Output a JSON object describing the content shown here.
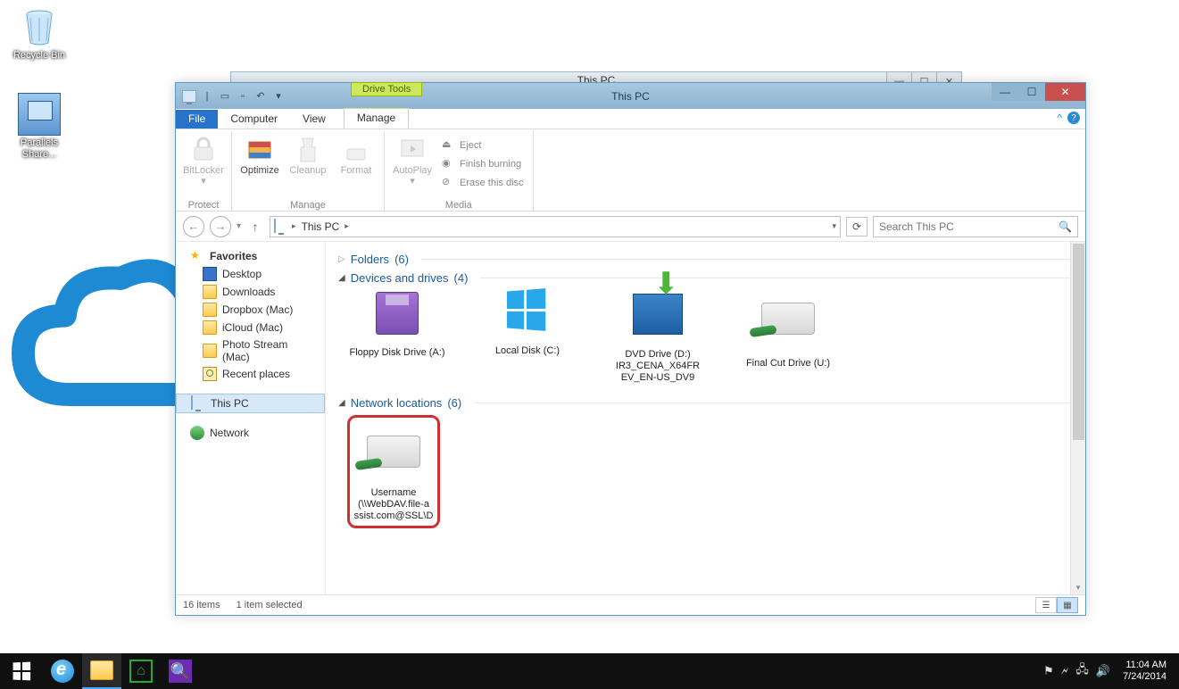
{
  "desktop": {
    "recycle_bin": "Recycle Bin",
    "parallels": "Parallels Share..."
  },
  "bg_window": {
    "title": "This PC"
  },
  "explorer": {
    "context_tab": "Drive Tools",
    "title": "This PC",
    "tabs": {
      "file": "File",
      "computer": "Computer",
      "view": "View",
      "manage": "Manage"
    },
    "ribbon": {
      "protect": {
        "bitlocker": "BitLocker",
        "label": "Protect"
      },
      "manage": {
        "optimize": "Optimize",
        "cleanup": "Cleanup",
        "format": "Format",
        "label": "Manage"
      },
      "media": {
        "autoplay": "AutoPlay",
        "eject": "Eject",
        "finish": "Finish burning",
        "erase": "Erase this disc",
        "label": "Media"
      }
    },
    "address": {
      "location": "This PC"
    },
    "search": {
      "placeholder": "Search This PC"
    },
    "nav": {
      "favorites": "Favorites",
      "items": [
        "Desktop",
        "Downloads",
        "Dropbox (Mac)",
        "iCloud (Mac)",
        "Photo Stream (Mac)",
        "Recent places"
      ],
      "this_pc": "This PC",
      "network": "Network"
    },
    "sections": {
      "folders": {
        "label": "Folders",
        "count": "(6)"
      },
      "devices": {
        "label": "Devices and drives",
        "count": "(4)"
      },
      "network": {
        "label": "Network locations",
        "count": "(6)"
      }
    },
    "drives": {
      "floppy": "Floppy Disk Drive (A:)",
      "local": "Local Disk (C:)",
      "dvd_l1": "DVD Drive (D:)",
      "dvd_l2": "IR3_CENA_X64FR",
      "dvd_l3": "EV_EN-US_DV9",
      "fcut": "Final Cut Drive (U:)",
      "webdav_l1": "Username",
      "webdav_l2": "(\\\\WebDAV.file-a",
      "webdav_l3": "ssist.com@SSL\\D"
    },
    "status": {
      "items": "16 items",
      "selected": "1 item selected"
    }
  },
  "taskbar": {
    "time": "11:04 AM",
    "date": "7/24/2014"
  }
}
